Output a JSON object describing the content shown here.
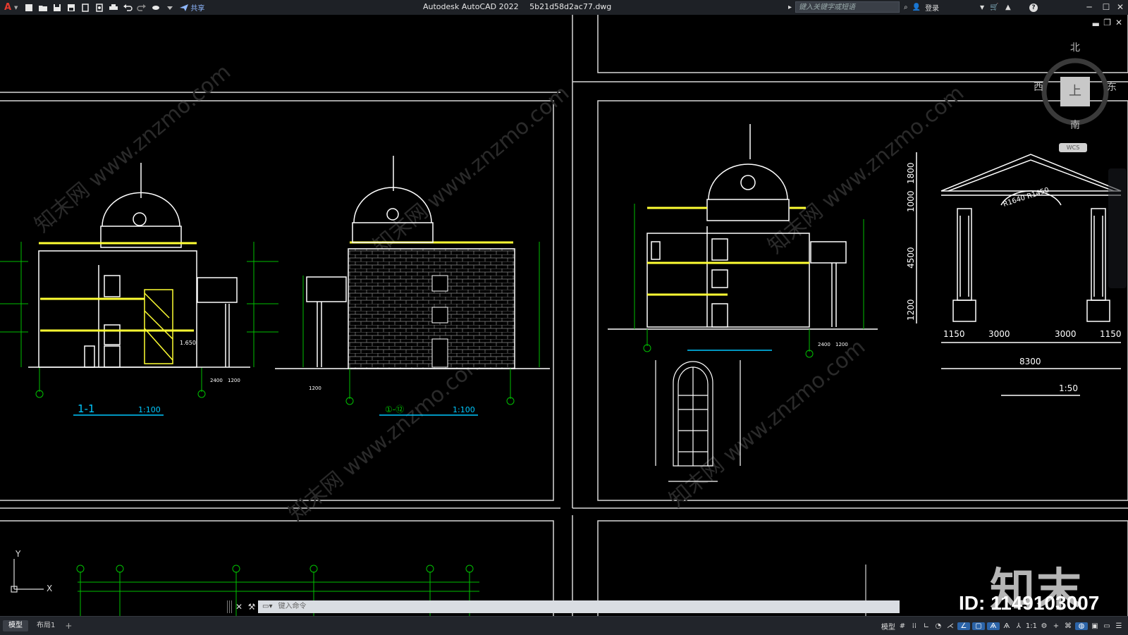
{
  "app": {
    "logo_letter": "A",
    "title_app": "Autodesk AutoCAD 2022",
    "title_file": "5b21d58d2ac77.dwg",
    "share_label": "共享",
    "search_placeholder": "键入关键字或短语",
    "login_label": "登录",
    "help_label": "?"
  },
  "drawing": {
    "section_label": "1-1",
    "section_scale": "1:100",
    "elevation_axis_label": "①-⑫",
    "elevation_scale": "1:100",
    "gate_dims_top": [
      "1150",
      "3000",
      "3000",
      "1150"
    ],
    "gate_dim_total": "8300",
    "gate_dims_side": [
      "1800",
      "1000",
      "4500",
      "1200"
    ],
    "gate_arch_label": "R1640 R1450",
    "gate_scale": "1:50",
    "dim_2400": "2400",
    "dim_1200": "1200",
    "level_1650": "1.650"
  },
  "viewcube": {
    "north": "北",
    "south": "南",
    "west": "西",
    "east": "东",
    "face": "上",
    "wcs": "WCS"
  },
  "ucs": {
    "x": "X",
    "y": "Y"
  },
  "command": {
    "placeholder": "键入命令"
  },
  "watermark": {
    "logo": "知末",
    "id": "ID: 1149103007"
  },
  "status": {
    "tab_model": "模型",
    "tab_layout": "布局1",
    "tab_add": "+",
    "model_label": "模型",
    "scale": "1:1"
  },
  "colors": {
    "green": "#00c000",
    "yellow": "#ffff33",
    "white": "#ffffff",
    "cyan": "#00c8ff",
    "frame": "#d8d8d8"
  }
}
